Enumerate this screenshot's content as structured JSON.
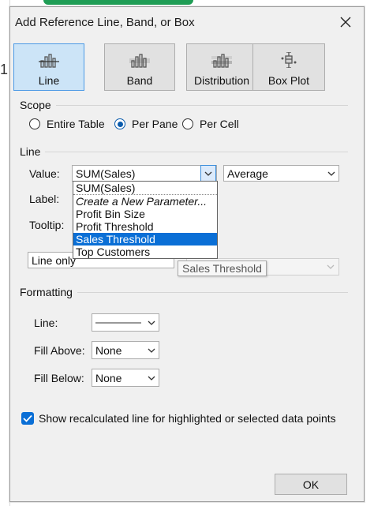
{
  "dialog": {
    "title": "Add Reference Line, Band, or Box",
    "tabs": [
      {
        "label": "Line",
        "icon": "line-icon",
        "active": true
      },
      {
        "label": "Band",
        "icon": "band-icon",
        "active": false
      },
      {
        "label": "Distribution",
        "icon": "distribution-icon",
        "active": false
      },
      {
        "label": "Box Plot",
        "icon": "box-plot-icon",
        "active": false
      }
    ],
    "scope": {
      "label": "Scope",
      "options": [
        "Entire Table",
        "Per Pane",
        "Per Cell"
      ],
      "selected": "Per Pane"
    },
    "line": {
      "label": "Line",
      "value_label": "Value:",
      "value": "SUM(Sales)",
      "aggregation": "Average",
      "label_label": "Label:",
      "tooltip_label": "Tooltip:",
      "line_only": "Line only",
      "dropdown_items": [
        "SUM(Sales)",
        "Create a New Parameter...",
        "Profit Bin Size",
        "Profit Threshold",
        "Sales Threshold",
        "Top Customers"
      ],
      "dropdown_selected": "Sales Threshold",
      "hover_tooltip": "Sales Threshold"
    },
    "formatting": {
      "label": "Formatting",
      "line_label": "Line:",
      "fill_above_label": "Fill Above:",
      "fill_above_value": "None",
      "fill_below_label": "Fill Below:",
      "fill_below_value": "None"
    },
    "recalc_checkbox": {
      "label": "Show recalculated line for highlighted or selected data points",
      "checked": true
    },
    "ok_label": "OK"
  },
  "background": {
    "partial_text": "1"
  },
  "colors": {
    "accent": "#0a6fd6",
    "active_tab": "#cce4f7",
    "green_strip": "#1f9d55"
  }
}
